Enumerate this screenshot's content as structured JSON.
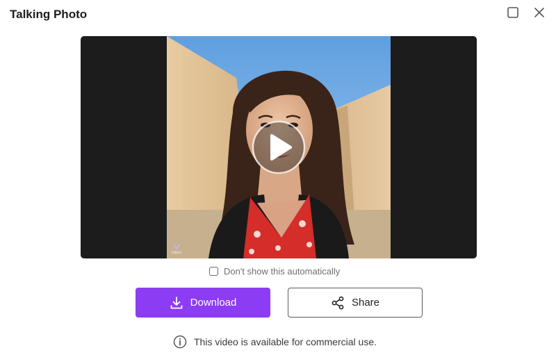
{
  "window": {
    "title": "Talking Photo",
    "maximize_icon": "maximize-icon",
    "close_icon": "close-icon"
  },
  "video": {
    "play_icon": "play-icon",
    "watermark": "Vidnoz"
  },
  "options": {
    "dont_show_label": "Don't show this automatically",
    "dont_show_checked": false
  },
  "actions": {
    "download_label": "Download",
    "download_icon": "download-icon",
    "share_label": "Share",
    "share_icon": "share-icon"
  },
  "footer": {
    "info_icon": "info-icon",
    "info_text": "This video is available for commercial use."
  },
  "colors": {
    "accent": "#8c3cf3",
    "video_background": "#1c1c1c"
  }
}
